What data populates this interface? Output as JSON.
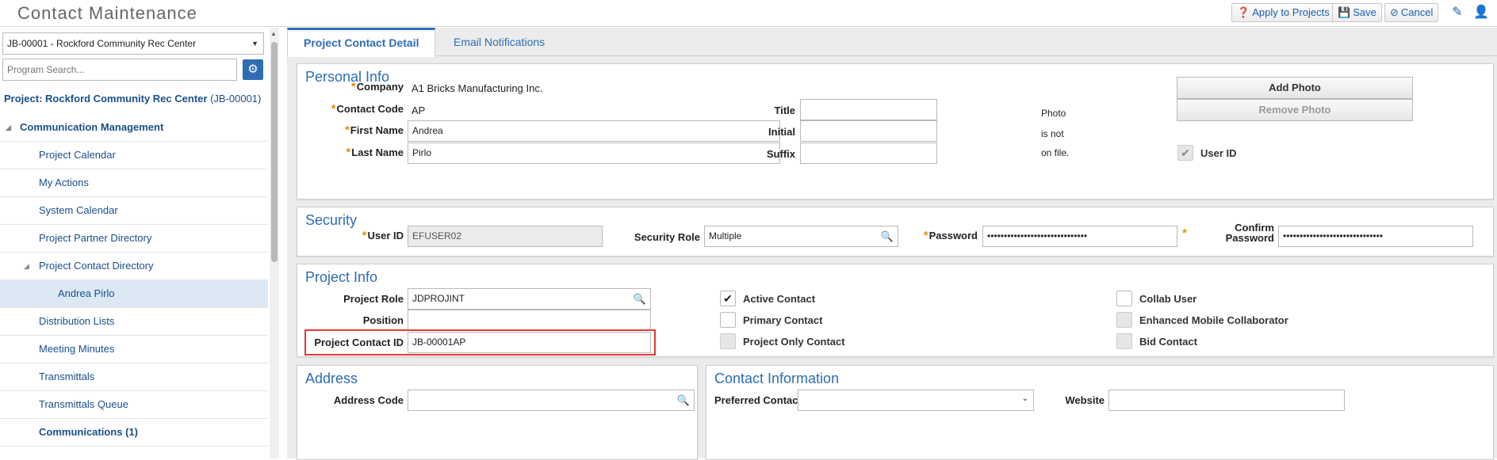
{
  "app": {
    "title": "Contact Maintenance"
  },
  "toolbar": {
    "apply_label": "Apply to Projects",
    "save_label": "Save",
    "cancel_label": "Cancel"
  },
  "sidebar": {
    "project_select": "JB-00001 - Rockford Community Rec Center",
    "search_placeholder": "Program Search...",
    "heading_prefix": "Project: Rockford Community Rec Center",
    "heading_code": "(JB-00001)",
    "items": [
      {
        "label": "Communication Management"
      },
      {
        "label": "Project Calendar"
      },
      {
        "label": "My Actions"
      },
      {
        "label": "System Calendar"
      },
      {
        "label": "Project Partner Directory"
      },
      {
        "label": "Project Contact Directory"
      },
      {
        "label": "Andrea Pirlo"
      },
      {
        "label": "Distribution Lists"
      },
      {
        "label": "Meeting Minutes"
      },
      {
        "label": "Transmittals"
      },
      {
        "label": "Transmittals Queue"
      },
      {
        "label": "Communications (1)"
      }
    ]
  },
  "tabs": [
    {
      "label": "Project Contact Detail"
    },
    {
      "label": "Email Notifications"
    }
  ],
  "personal": {
    "title": "Personal Info",
    "company_label": "Company",
    "company_value": "A1 Bricks Manufacturing Inc.",
    "contact_code_label": "Contact Code",
    "contact_code_value": "AP",
    "first_name_label": "First Name",
    "first_name_value": "Andrea",
    "last_name_label": "Last Name",
    "last_name_value": "Pirlo",
    "title_label": "Title",
    "title_value": "",
    "initial_label": "Initial",
    "initial_value": "",
    "suffix_label": "Suffix",
    "suffix_value": "",
    "photo_line1": "Photo",
    "photo_line2": "is not",
    "photo_line3": "on file.",
    "add_photo_label": "Add Photo",
    "remove_photo_label": "Remove Photo",
    "user_id_check_label": "User ID",
    "user_id_checked": true
  },
  "security": {
    "title": "Security",
    "user_id_label": "User ID",
    "user_id_value": "EFUSER02",
    "role_label": "Security Role",
    "role_value": "Multiple",
    "password_label": "Password",
    "password_value": "••••••••••••••••••••••••••••••",
    "confirm_label_1": "Confirm",
    "confirm_label_2": "Password",
    "confirm_value": "••••••••••••••••••••••••••••••"
  },
  "project_info": {
    "title": "Project Info",
    "role_label": "Project Role",
    "role_value": "JDPROJINT",
    "position_label": "Position",
    "position_value": "",
    "contact_id_label": "Project Contact ID",
    "contact_id_value": "JB-00001AP",
    "checkboxes": [
      {
        "label": "Active Contact",
        "checked": true
      },
      {
        "label": "Primary Contact",
        "checked": false
      },
      {
        "label": "Project Only Contact",
        "checked": false
      },
      {
        "label": "Collab User",
        "checked": false
      },
      {
        "label": "Enhanced Mobile Collaborator",
        "checked": false
      },
      {
        "label": "Bid Contact",
        "checked": false
      }
    ]
  },
  "address": {
    "title": "Address",
    "code_label": "Address Code",
    "code_value": ""
  },
  "contact_information": {
    "title": "Contact Information",
    "preferred_label": "Preferred Contact",
    "preferred_value": "",
    "website_label": "Website",
    "website_value": ""
  },
  "colors": {
    "accent": "#2d6db5",
    "required": "#f08c00",
    "highlight": "#e53935"
  }
}
